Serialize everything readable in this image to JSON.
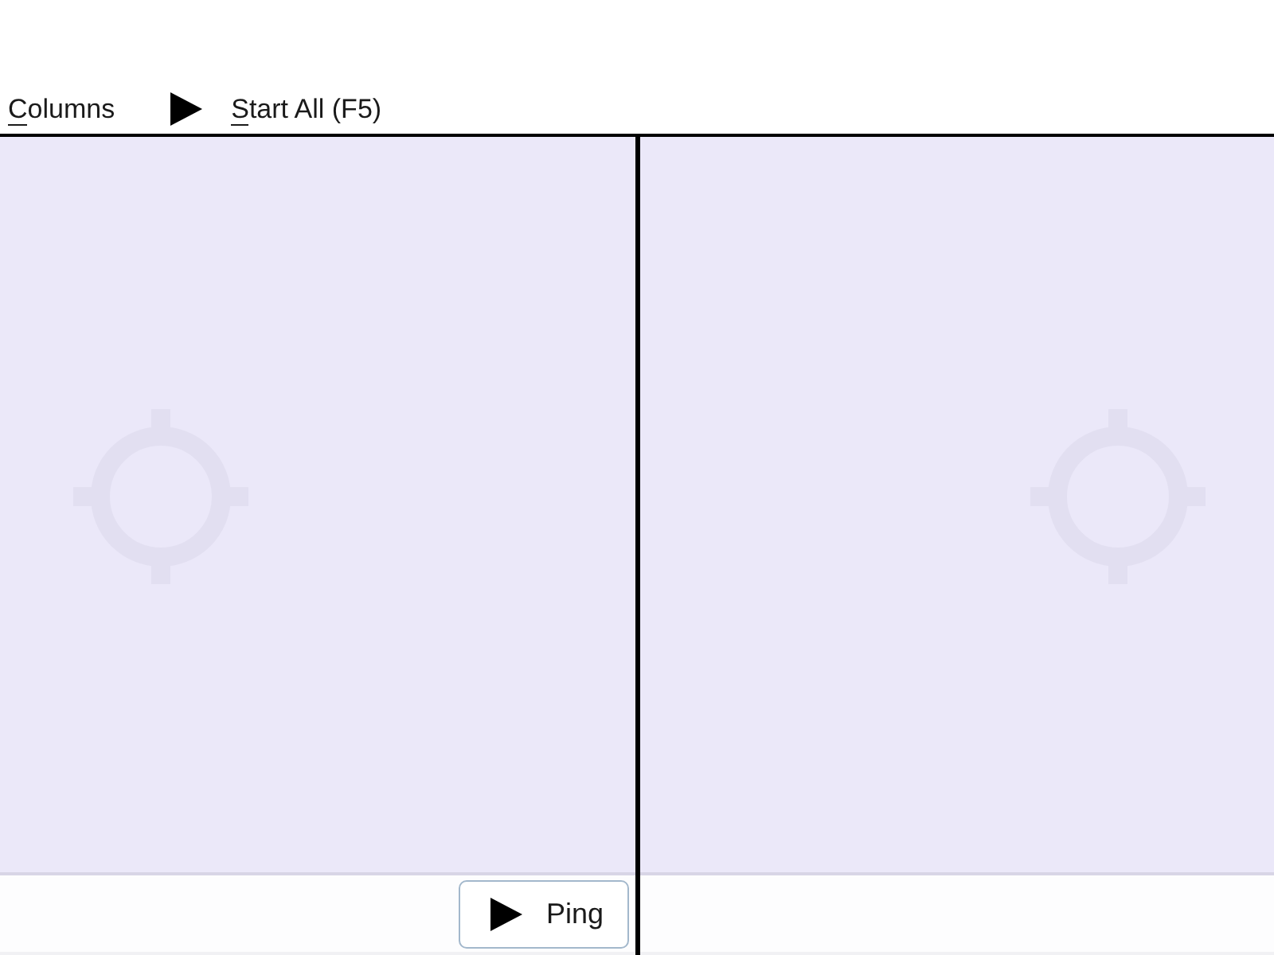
{
  "toolbar": {
    "items": [
      {
        "kind": "menu",
        "label": "Columns",
        "access_key": true
      },
      {
        "kind": "play",
        "label": "Start All (F5)",
        "access_key": true
      }
    ]
  },
  "panes": [
    {
      "kind": "with_button",
      "button": {
        "label": "Ping"
      }
    },
    {
      "kind": "empty"
    }
  ]
}
